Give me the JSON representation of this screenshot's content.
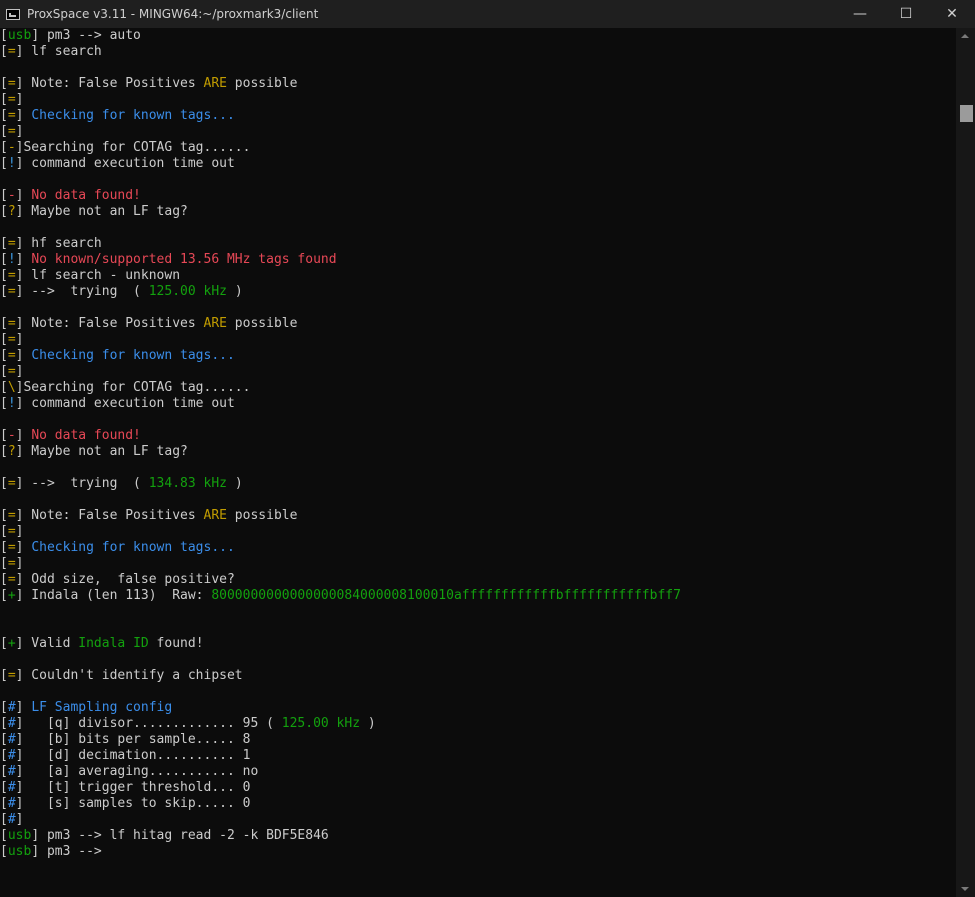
{
  "window": {
    "title": "ProxSpace v3.11 - MINGW64:~/proxmark3/client",
    "minimize": "—",
    "maximize": "☐",
    "close": "✕"
  },
  "colors": {
    "default": "#cccccc",
    "yellow": "#c19c00",
    "green": "#13a10e",
    "blue": "#3b8eea",
    "red": "#e74856",
    "cyan": "#3a96dd"
  },
  "terminal": {
    "lines": [
      [
        {
          "t": "[",
          "c": "default"
        },
        {
          "t": "usb",
          "c": "green"
        },
        {
          "t": "] pm3 --> auto",
          "c": "default"
        }
      ],
      [
        {
          "t": "[",
          "c": "default"
        },
        {
          "t": "=",
          "c": "yellow"
        },
        {
          "t": "] lf search",
          "c": "default"
        }
      ],
      [],
      [
        {
          "t": "[",
          "c": "default"
        },
        {
          "t": "=",
          "c": "yellow"
        },
        {
          "t": "] Note: False Positives ",
          "c": "default"
        },
        {
          "t": "ARE",
          "c": "yellow"
        },
        {
          "t": " possible",
          "c": "default"
        }
      ],
      [
        {
          "t": "[",
          "c": "default"
        },
        {
          "t": "=",
          "c": "yellow"
        },
        {
          "t": "]",
          "c": "default"
        }
      ],
      [
        {
          "t": "[",
          "c": "default"
        },
        {
          "t": "=",
          "c": "yellow"
        },
        {
          "t": "] ",
          "c": "default"
        },
        {
          "t": "Checking for known tags...",
          "c": "blue"
        }
      ],
      [
        {
          "t": "[",
          "c": "default"
        },
        {
          "t": "=",
          "c": "yellow"
        },
        {
          "t": "]",
          "c": "default"
        }
      ],
      [
        {
          "t": "[",
          "c": "default"
        },
        {
          "t": "-",
          "c": "yellow"
        },
        {
          "t": "]Searching for COTAG tag......",
          "c": "default"
        }
      ],
      [
        {
          "t": "[",
          "c": "default"
        },
        {
          "t": "!",
          "c": "cyan"
        },
        {
          "t": "] command execution time out",
          "c": "default"
        }
      ],
      [],
      [
        {
          "t": "[",
          "c": "default"
        },
        {
          "t": "-",
          "c": "red"
        },
        {
          "t": "] ",
          "c": "default"
        },
        {
          "t": "No data found!",
          "c": "red"
        }
      ],
      [
        {
          "t": "[",
          "c": "default"
        },
        {
          "t": "?",
          "c": "yellow"
        },
        {
          "t": "] Maybe not an LF tag?",
          "c": "default"
        }
      ],
      [],
      [
        {
          "t": "[",
          "c": "default"
        },
        {
          "t": "=",
          "c": "yellow"
        },
        {
          "t": "] hf search",
          "c": "default"
        }
      ],
      [
        {
          "t": "[",
          "c": "default"
        },
        {
          "t": "!",
          "c": "cyan"
        },
        {
          "t": "] ",
          "c": "default"
        },
        {
          "t": "No known/supported 13.56 MHz tags found",
          "c": "red"
        }
      ],
      [
        {
          "t": "[",
          "c": "default"
        },
        {
          "t": "=",
          "c": "yellow"
        },
        {
          "t": "] lf search - unknown",
          "c": "default"
        }
      ],
      [
        {
          "t": "[",
          "c": "default"
        },
        {
          "t": "=",
          "c": "yellow"
        },
        {
          "t": "] -->  trying  ( ",
          "c": "default"
        },
        {
          "t": "125.00 kHz",
          "c": "green"
        },
        {
          "t": " )",
          "c": "default"
        }
      ],
      [],
      [
        {
          "t": "[",
          "c": "default"
        },
        {
          "t": "=",
          "c": "yellow"
        },
        {
          "t": "] Note: False Positives ",
          "c": "default"
        },
        {
          "t": "ARE",
          "c": "yellow"
        },
        {
          "t": " possible",
          "c": "default"
        }
      ],
      [
        {
          "t": "[",
          "c": "default"
        },
        {
          "t": "=",
          "c": "yellow"
        },
        {
          "t": "]",
          "c": "default"
        }
      ],
      [
        {
          "t": "[",
          "c": "default"
        },
        {
          "t": "=",
          "c": "yellow"
        },
        {
          "t": "] ",
          "c": "default"
        },
        {
          "t": "Checking for known tags...",
          "c": "blue"
        }
      ],
      [
        {
          "t": "[",
          "c": "default"
        },
        {
          "t": "=",
          "c": "yellow"
        },
        {
          "t": "]",
          "c": "default"
        }
      ],
      [
        {
          "t": "[",
          "c": "default"
        },
        {
          "t": "\\",
          "c": "yellow"
        },
        {
          "t": "]Searching for COTAG tag......",
          "c": "default"
        }
      ],
      [
        {
          "t": "[",
          "c": "default"
        },
        {
          "t": "!",
          "c": "cyan"
        },
        {
          "t": "] command execution time out",
          "c": "default"
        }
      ],
      [],
      [
        {
          "t": "[",
          "c": "default"
        },
        {
          "t": "-",
          "c": "red"
        },
        {
          "t": "] ",
          "c": "default"
        },
        {
          "t": "No data found!",
          "c": "red"
        }
      ],
      [
        {
          "t": "[",
          "c": "default"
        },
        {
          "t": "?",
          "c": "yellow"
        },
        {
          "t": "] Maybe not an LF tag?",
          "c": "default"
        }
      ],
      [],
      [
        {
          "t": "[",
          "c": "default"
        },
        {
          "t": "=",
          "c": "yellow"
        },
        {
          "t": "] -->  trying  ( ",
          "c": "default"
        },
        {
          "t": "134.83 kHz",
          "c": "green"
        },
        {
          "t": " )",
          "c": "default"
        }
      ],
      [],
      [
        {
          "t": "[",
          "c": "default"
        },
        {
          "t": "=",
          "c": "yellow"
        },
        {
          "t": "] Note: False Positives ",
          "c": "default"
        },
        {
          "t": "ARE",
          "c": "yellow"
        },
        {
          "t": " possible",
          "c": "default"
        }
      ],
      [
        {
          "t": "[",
          "c": "default"
        },
        {
          "t": "=",
          "c": "yellow"
        },
        {
          "t": "]",
          "c": "default"
        }
      ],
      [
        {
          "t": "[",
          "c": "default"
        },
        {
          "t": "=",
          "c": "yellow"
        },
        {
          "t": "] ",
          "c": "default"
        },
        {
          "t": "Checking for known tags...",
          "c": "blue"
        }
      ],
      [
        {
          "t": "[",
          "c": "default"
        },
        {
          "t": "=",
          "c": "yellow"
        },
        {
          "t": "]",
          "c": "default"
        }
      ],
      [
        {
          "t": "[",
          "c": "default"
        },
        {
          "t": "=",
          "c": "yellow"
        },
        {
          "t": "] Odd size,  false positive?",
          "c": "default"
        }
      ],
      [
        {
          "t": "[",
          "c": "default"
        },
        {
          "t": "+",
          "c": "green"
        },
        {
          "t": "] Indala (len 113)  Raw: ",
          "c": "default"
        },
        {
          "t": "8000000000000000084000008100010affffffffffffbfffffffffffbff7",
          "c": "green"
        }
      ],
      [],
      [],
      [
        {
          "t": "[",
          "c": "default"
        },
        {
          "t": "+",
          "c": "green"
        },
        {
          "t": "] Valid ",
          "c": "default"
        },
        {
          "t": "Indala ID",
          "c": "green"
        },
        {
          "t": " found!",
          "c": "default"
        }
      ],
      [],
      [
        {
          "t": "[",
          "c": "default"
        },
        {
          "t": "=",
          "c": "yellow"
        },
        {
          "t": "] Couldn't identify a chipset",
          "c": "default"
        }
      ],
      [],
      [
        {
          "t": "[",
          "c": "default"
        },
        {
          "t": "#",
          "c": "blue"
        },
        {
          "t": "] ",
          "c": "default"
        },
        {
          "t": "LF Sampling config",
          "c": "blue"
        }
      ],
      [
        {
          "t": "[",
          "c": "default"
        },
        {
          "t": "#",
          "c": "blue"
        },
        {
          "t": "]   [q] divisor............. 95 ( ",
          "c": "default"
        },
        {
          "t": "125.00 kHz",
          "c": "green"
        },
        {
          "t": " )",
          "c": "default"
        }
      ],
      [
        {
          "t": "[",
          "c": "default"
        },
        {
          "t": "#",
          "c": "blue"
        },
        {
          "t": "]   [b] bits per sample..... 8",
          "c": "default"
        }
      ],
      [
        {
          "t": "[",
          "c": "default"
        },
        {
          "t": "#",
          "c": "blue"
        },
        {
          "t": "]   [d] decimation.......... 1",
          "c": "default"
        }
      ],
      [
        {
          "t": "[",
          "c": "default"
        },
        {
          "t": "#",
          "c": "blue"
        },
        {
          "t": "]   [a] averaging........... no",
          "c": "default"
        }
      ],
      [
        {
          "t": "[",
          "c": "default"
        },
        {
          "t": "#",
          "c": "blue"
        },
        {
          "t": "]   [t] trigger threshold... 0",
          "c": "default"
        }
      ],
      [
        {
          "t": "[",
          "c": "default"
        },
        {
          "t": "#",
          "c": "blue"
        },
        {
          "t": "]   [s] samples to skip..... 0",
          "c": "default"
        }
      ],
      [
        {
          "t": "[",
          "c": "default"
        },
        {
          "t": "#",
          "c": "blue"
        },
        {
          "t": "]",
          "c": "default"
        }
      ],
      [
        {
          "t": "[",
          "c": "default"
        },
        {
          "t": "usb",
          "c": "green"
        },
        {
          "t": "] pm3 --> lf hitag read -2 -k BDF5E846",
          "c": "default"
        }
      ],
      [
        {
          "t": "[",
          "c": "default"
        },
        {
          "t": "usb",
          "c": "green"
        },
        {
          "t": "] pm3 -->",
          "c": "default"
        }
      ]
    ]
  }
}
